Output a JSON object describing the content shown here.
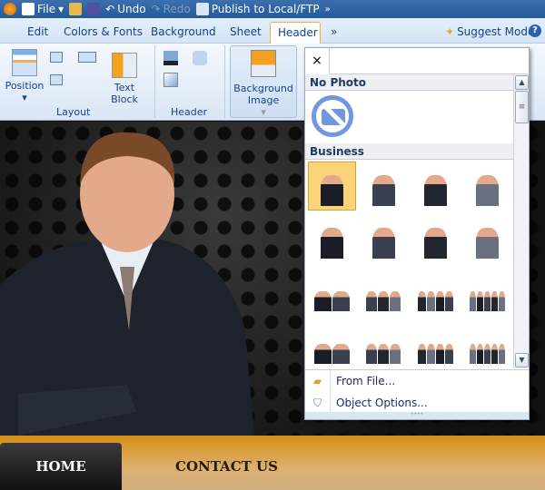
{
  "titlebar": {
    "file": "File",
    "undo": "Undo",
    "redo": "Redo",
    "publish": "Publish to Local/FTP",
    "more": "»"
  },
  "tabs": [
    {
      "label": "Edit"
    },
    {
      "label": "Colors & Fonts"
    },
    {
      "label": "Background"
    },
    {
      "label": "Sheet"
    },
    {
      "label": "Header",
      "active": true
    },
    {
      "label": "»"
    }
  ],
  "suggest_mode": "Suggest Mode",
  "ribbon": {
    "position": "Position",
    "text_block_1": "Text",
    "text_block_2": "Block",
    "layout": "Layout",
    "header": "Header",
    "bg_image_1": "Background",
    "bg_image_2": "Image"
  },
  "popup": {
    "close": "×",
    "no_photo": "No Photo",
    "business": "Business",
    "from_file": "From File...",
    "object_options": "Object Options...",
    "selected_index": 0,
    "thumbnail_count": 16
  },
  "site": {
    "nav": [
      "HOME",
      "CONTACT US"
    ]
  },
  "colors": {
    "accent": "#f0b040",
    "ribbon_text": "#15428b",
    "nav_orange": "#d68e12"
  }
}
